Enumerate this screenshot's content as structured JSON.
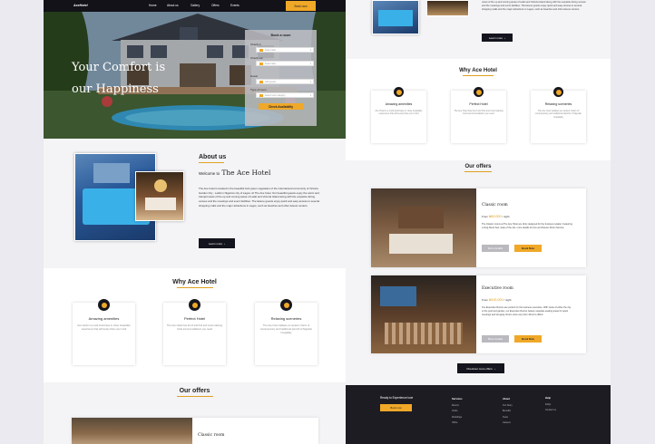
{
  "nav": {
    "brand": "AceHotel",
    "links": [
      "Home",
      "About us",
      "Gallery",
      "Offers",
      "Events"
    ],
    "book_now": "Book now"
  },
  "hero": {
    "headline_line1": "Your Comfort is",
    "headline_line2": "our Happiness",
    "booking": {
      "title": "Book a room",
      "check_in_label": "Check in",
      "check_in_placeholder": "Select date",
      "check_out_label": "Check out",
      "check_out_placeholder": "Select date",
      "guest_label": "Guest",
      "guest_placeholder": "Add guests",
      "room_type_label": "Type of room",
      "room_type_placeholder": "Select room category",
      "submit": "Check Availability"
    }
  },
  "about": {
    "heading": "About us",
    "welcome_prefix": "Welcome to",
    "hotel_name": "The Ace Hotel",
    "body": "The Ace hotel is located in the beautiful lush green vegetation of the international community of Victoria Garden City - Lekki in Nigeria's city of Lagos. At The Ace hotel, Our beautiful guests enjoy the warm and tranquil views of the up and coming areas of Lekki and Victoria Island along with the exquisite dining venues and the meetings and event facilities. The leisure guests enjoy quick and easy access to several shopping malls and the major attractions in Lagos, such as beaches and other leisure centers.",
    "top_excerpt": "views of the up and coming areas of Lekki and Victoria Island along with the exquisite dining venues and the meetings and event facilities. The leisure guests enjoy quick and easy access to several shopping malls and the major attractions in Lagos, such as beaches and other leisure centers.",
    "learn_more": "Learn more"
  },
  "why": {
    "heading": "Why Ace Hotel",
    "cards": [
      {
        "title": "Amazing amenities",
        "icon": "smile-icon",
        "text": "Ace Hotel is a multi-local base in close hospitality experience that will surely blow your mind"
      },
      {
        "title": "Perfect Hotel",
        "icon": "hotel-icon",
        "text": "The Ace Hotel has the 8 and find and most relaxing hotel accommodations you need"
      },
      {
        "title": "Relaxing sceneries",
        "icon": "heart-icon",
        "text": "The Ace hotel radiates an opulent charm of contemporary and traditional warmth of Nigerian hospitality"
      }
    ]
  },
  "offers": {
    "heading": "Our offers",
    "rooms": [
      {
        "name": "Classic room",
        "price_prefix": "From",
        "price": "₦50,000",
        "price_suffix": "/ night",
        "description": "The Classic rooms at The Ace Hotel are clinic designed for the business retailer. Featuring a King-Sized bed, state of the sits, more details for Ace and Deluxe Room Service.",
        "details": "More details",
        "book": "Book Now"
      },
      {
        "name": "Executive room",
        "price_prefix": "From",
        "price": "₦100,000",
        "price_suffix": "/ night",
        "description": "Our Executive Rooms are perfect for the business executive. With views of either the city or the pool and garden, our Executive Rooms feature separate seating areas for quick meetings and lounging. Room sizes vary from 42m2 to 48m2.",
        "details": "More details",
        "book": "Book Now"
      }
    ],
    "checkout_more": "Checkout more offers"
  },
  "footer": {
    "cta_text": "Ready to Experience luxe",
    "cta_button": "Book now",
    "columns": [
      {
        "title": "Services",
        "items": [
          "Rooms",
          "Clubs",
          "Weddings",
          "Office"
        ]
      },
      {
        "title": "About",
        "items": [
          "Our Story",
          "Benefits",
          "Team",
          "Careers"
        ]
      },
      {
        "title": "Help",
        "items": [
          "FAQs",
          "Contact us"
        ]
      }
    ]
  }
}
